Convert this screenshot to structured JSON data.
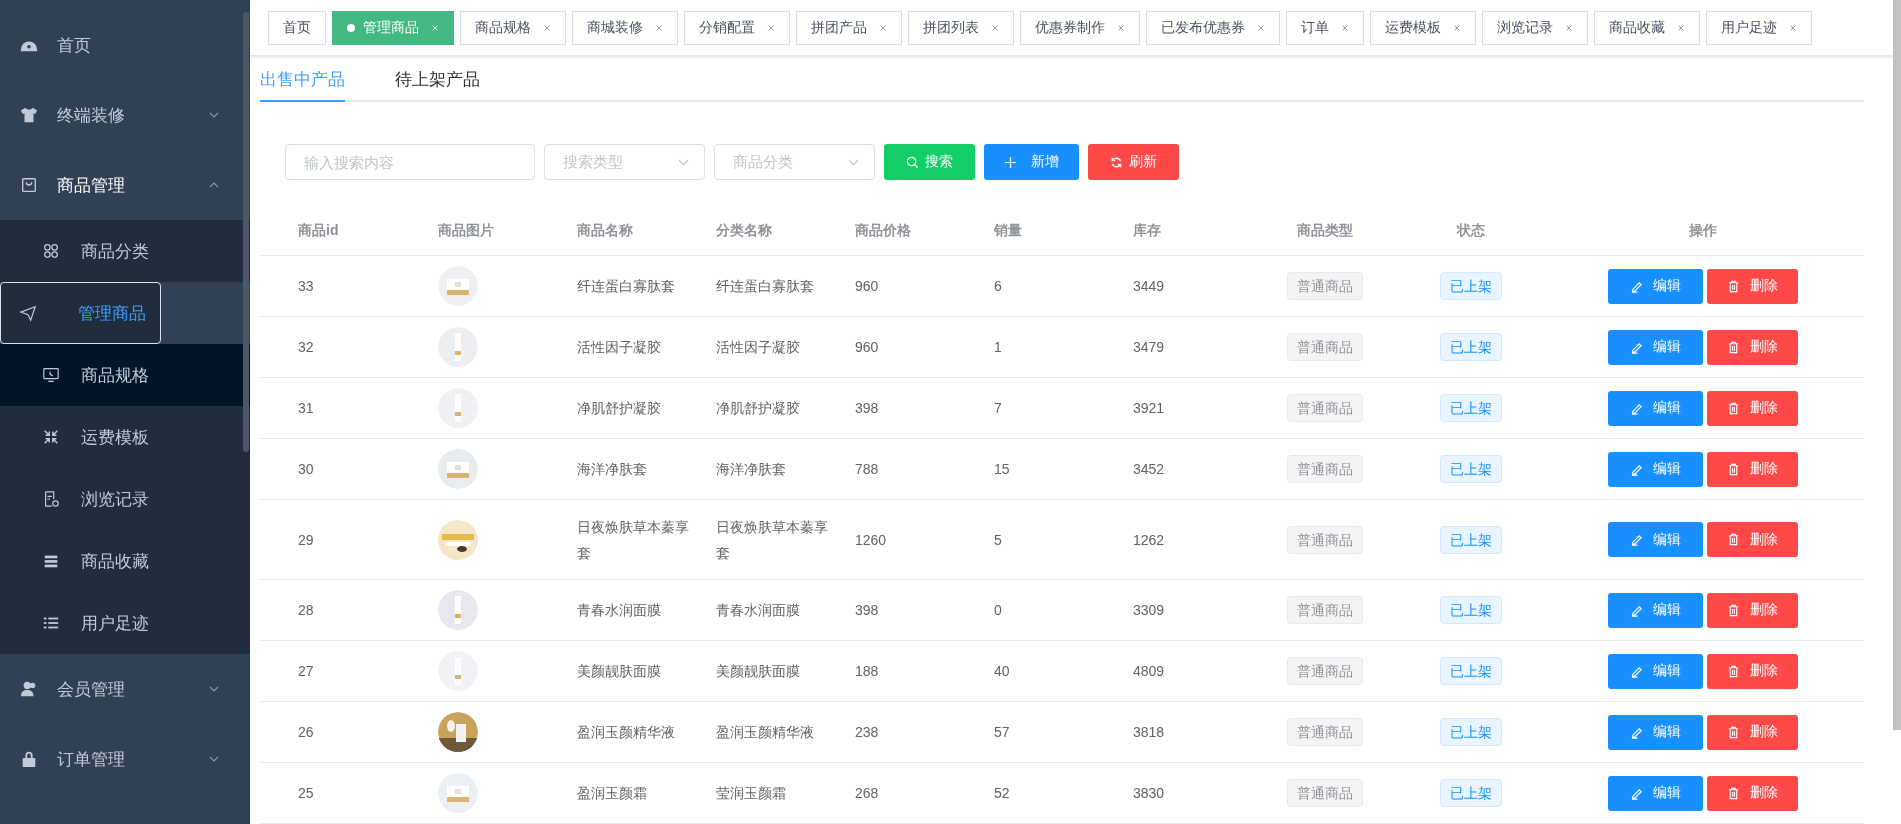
{
  "sidebar": {
    "items": [
      {
        "label": "首页"
      },
      {
        "label": "终端装修",
        "expanded": false
      },
      {
        "label": "商品管理",
        "expanded": true,
        "children": [
          {
            "label": "商品分类",
            "selected": false,
            "highlighted": false
          },
          {
            "label": "管理商品",
            "selected": true,
            "highlighted": false
          },
          {
            "label": "商品规格",
            "selected": false,
            "highlighted": true
          },
          {
            "label": "运费模板",
            "selected": false,
            "highlighted": false
          },
          {
            "label": "浏览记录",
            "selected": false,
            "highlighted": false
          },
          {
            "label": "商品收藏",
            "selected": false,
            "highlighted": false
          },
          {
            "label": "用户足迹",
            "selected": false,
            "highlighted": false
          }
        ]
      },
      {
        "label": "会员管理",
        "expanded": false
      },
      {
        "label": "订单管理",
        "expanded": false
      }
    ]
  },
  "tags": [
    {
      "label": "首页",
      "selected": false,
      "closable": false
    },
    {
      "label": "管理商品",
      "selected": true,
      "closable": true
    },
    {
      "label": "商品规格",
      "selected": false,
      "closable": true
    },
    {
      "label": "商城装修",
      "selected": false,
      "closable": true
    },
    {
      "label": "分销配置",
      "selected": false,
      "closable": true
    },
    {
      "label": "拼团产品",
      "selected": false,
      "closable": true
    },
    {
      "label": "拼团列表",
      "selected": false,
      "closable": true
    },
    {
      "label": "优惠券制作",
      "selected": false,
      "closable": true
    },
    {
      "label": "已发布优惠券",
      "selected": false,
      "closable": true
    },
    {
      "label": "订单",
      "selected": false,
      "closable": true
    },
    {
      "label": "运费模板",
      "selected": false,
      "closable": true
    },
    {
      "label": "浏览记录",
      "selected": false,
      "closable": true
    },
    {
      "label": "商品收藏",
      "selected": false,
      "closable": true
    },
    {
      "label": "用户足迹",
      "selected": false,
      "closable": true
    }
  ],
  "tabs": [
    {
      "label": "出售中产品",
      "selected": true
    },
    {
      "label": "待上架产品",
      "selected": false
    }
  ],
  "toolbar": {
    "search": {
      "placeholder": "输入搜索内容"
    },
    "selects": [
      {
        "placeholder": "搜索类型"
      },
      {
        "placeholder": "商品分类"
      }
    ],
    "buttons": [
      {
        "label": "搜索",
        "kind": "search"
      },
      {
        "label": "新增",
        "kind": "add"
      },
      {
        "label": "刷新",
        "kind": "refresh"
      }
    ]
  },
  "table": {
    "columns": [
      "商品id",
      "商品图片",
      "商品名称",
      "分类名称",
      "商品价格",
      "销量",
      "库存",
      "商品类型",
      "状态",
      "操作"
    ],
    "rows": [
      {
        "id": "33",
        "name": "纤连蛋白寡肽套",
        "category": "纤连蛋白寡肽套",
        "price": "960",
        "sales": "6",
        "stock": "3449",
        "type": "普通商品",
        "status": "已上架",
        "actions": [
          "编辑",
          "删除"
        ]
      },
      {
        "id": "32",
        "name": "活性因子凝胶",
        "category": "活性因子凝胶",
        "price": "960",
        "sales": "1",
        "stock": "3479",
        "type": "普通商品",
        "status": "已上架",
        "actions": [
          "编辑",
          "删除"
        ]
      },
      {
        "id": "31",
        "name": "净肌舒护凝胶",
        "category": "净肌舒护凝胶",
        "price": "398",
        "sales": "7",
        "stock": "3921",
        "type": "普通商品",
        "status": "已上架",
        "actions": [
          "编辑",
          "删除"
        ]
      },
      {
        "id": "30",
        "name": "海洋净肤套",
        "category": "海洋净肤套",
        "price": "788",
        "sales": "15",
        "stock": "3452",
        "type": "普通商品",
        "status": "已上架",
        "actions": [
          "编辑",
          "删除"
        ]
      },
      {
        "id": "29",
        "name": "日夜焕肤草本蓁享套",
        "category": "日夜焕肤草本蓁享套",
        "price": "1260",
        "sales": "5",
        "stock": "1262",
        "type": "普通商品",
        "status": "已上架",
        "actions": [
          "编辑",
          "删除"
        ]
      },
      {
        "id": "28",
        "name": "青春水润面膜",
        "category": "青春水润面膜",
        "price": "398",
        "sales": "0",
        "stock": "3309",
        "type": "普通商品",
        "status": "已上架",
        "actions": [
          "编辑",
          "删除"
        ]
      },
      {
        "id": "27",
        "name": "美颜靓肤面膜",
        "category": "美颜靓肤面膜",
        "price": "188",
        "sales": "40",
        "stock": "4809",
        "type": "普通商品",
        "status": "已上架",
        "actions": [
          "编辑",
          "删除"
        ]
      },
      {
        "id": "26",
        "name": "盈润玉颜精华液",
        "category": "盈润玉颜精华液",
        "price": "238",
        "sales": "57",
        "stock": "3818",
        "type": "普通商品",
        "status": "已上架",
        "actions": [
          "编辑",
          "删除"
        ]
      },
      {
        "id": "25",
        "name": "盈润玉颜霜",
        "category": "莹润玉颜霜",
        "price": "268",
        "sales": "52",
        "stock": "3830",
        "type": "普通商品",
        "status": "已上架",
        "actions": [
          "编辑",
          "删除"
        ]
      }
    ]
  }
}
